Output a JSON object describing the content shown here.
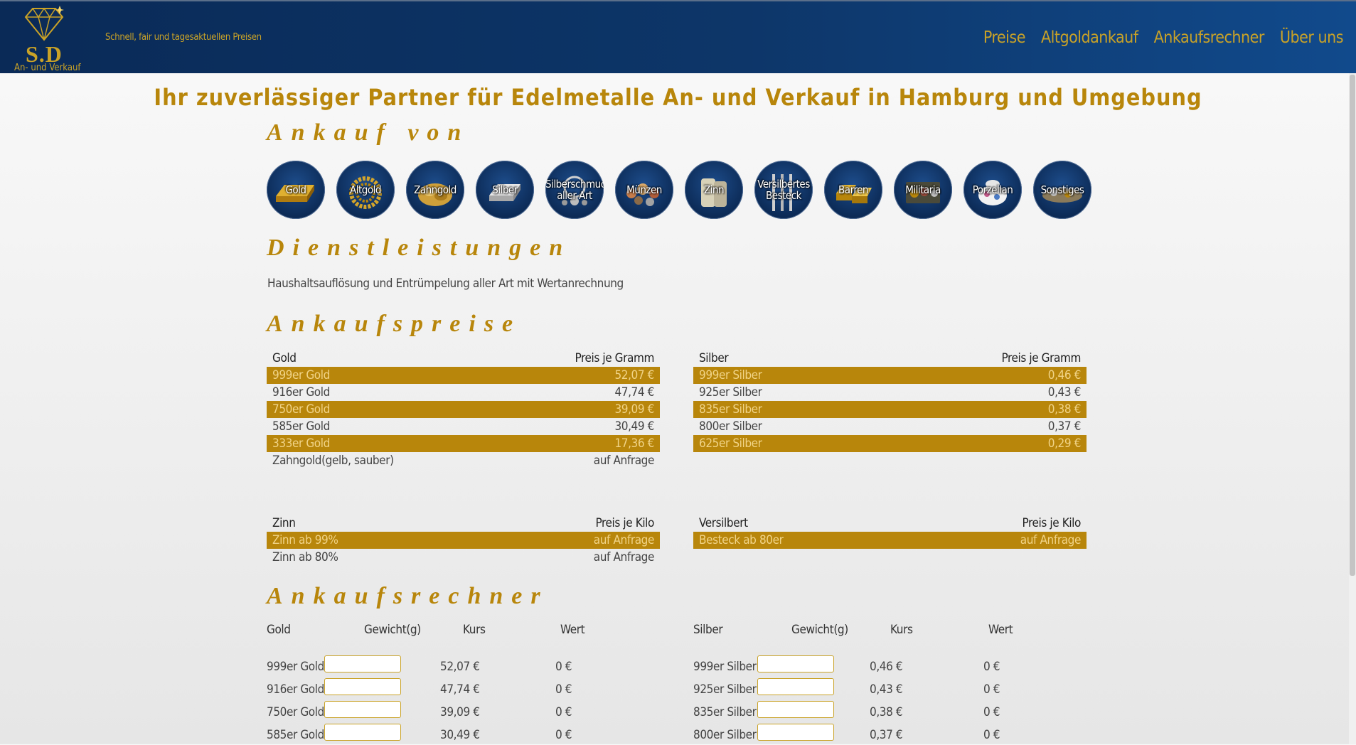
{
  "header": {
    "logo": {
      "mark": "S.D",
      "sub": "An- und Verkauf"
    },
    "tagline": "Schnell, fair und tagesaktuellen Preisen",
    "nav": [
      "Preise",
      "Altgoldankauf",
      "Ankaufsrechner",
      "Über uns"
    ]
  },
  "main": {
    "headline": "Ihr zuverlässiger Partner für Edelmetalle An- und Verkauf in Hamburg und Umgebung",
    "ankauf_title": "Ankauf von",
    "categories": [
      "Gold",
      "Altgold",
      "Zahngold",
      "Silber",
      "Silberschmuck aller Art",
      "Münzen",
      "Zinn",
      "Versilbertes Besteck",
      "Barren",
      "Militaria",
      "Porzellan",
      "Sonstiges"
    ],
    "dienst_title": "Dienstleistungen",
    "dienst_text": "Haushaltsauflösung und Entrümpelung aller Art mit Wertanrechnung",
    "preise_title": "Ankaufspreise",
    "gold_table": {
      "head": [
        "Gold",
        "Preis je Gramm"
      ],
      "rows": [
        [
          "999er Gold",
          "52,07 €"
        ],
        [
          "916er Gold",
          "47,74 €"
        ],
        [
          "750er Gold",
          "39,09 €"
        ],
        [
          "585er Gold",
          "30,49 €"
        ],
        [
          "333er Gold",
          "17,36 €"
        ],
        [
          "Zahngold(gelb, sauber)",
          "auf Anfrage"
        ]
      ]
    },
    "silber_table": {
      "head": [
        "Silber",
        "Preis je Gramm"
      ],
      "rows": [
        [
          "999er Silber",
          "0,46 €"
        ],
        [
          "925er Silber",
          "0,43 €"
        ],
        [
          "835er Silber",
          "0,38 €"
        ],
        [
          "800er Silber",
          "0,37 €"
        ],
        [
          "625er Silber",
          "0,29 €"
        ]
      ]
    },
    "zinn_table": {
      "head": [
        "Zinn",
        "Preis je Kilo"
      ],
      "rows": [
        [
          "Zinn ab 99%",
          "auf Anfrage"
        ],
        [
          "Zinn ab 80%",
          "auf Anfrage"
        ]
      ]
    },
    "versilbert_table": {
      "head": [
        "Versilbert",
        "Preis je Kilo"
      ],
      "rows": [
        [
          "Besteck ab 80er",
          "auf Anfrage"
        ]
      ]
    },
    "rechner_title": "Ankaufsrechner",
    "gold_calc": {
      "head": [
        "Gold",
        "Gewicht(g)",
        "Kurs",
        "Wert"
      ],
      "rows": [
        [
          "999er Gold",
          "52,07 €",
          "0 €"
        ],
        [
          "916er Gold",
          "47,74 €",
          "0 €"
        ],
        [
          "750er Gold",
          "39,09 €",
          "0 €"
        ],
        [
          "585er Gold",
          "30,49 €",
          "0 €"
        ]
      ]
    },
    "silber_calc": {
      "head": [
        "Silber",
        "Gewicht(g)",
        "Kurs",
        "Wert"
      ],
      "rows": [
        [
          "999er Silber",
          "0,46 €",
          "0 €"
        ],
        [
          "925er Silber",
          "0,43 €",
          "0 €"
        ],
        [
          "835er Silber",
          "0,38 €",
          "0 €"
        ],
        [
          "800er Silber",
          "0,37 €",
          "0 €"
        ]
      ]
    }
  },
  "colors": {
    "navy": "#0d3669",
    "gold": "#b8860b",
    "gold_text": "#c9a227",
    "row_text": "#f1d488"
  }
}
